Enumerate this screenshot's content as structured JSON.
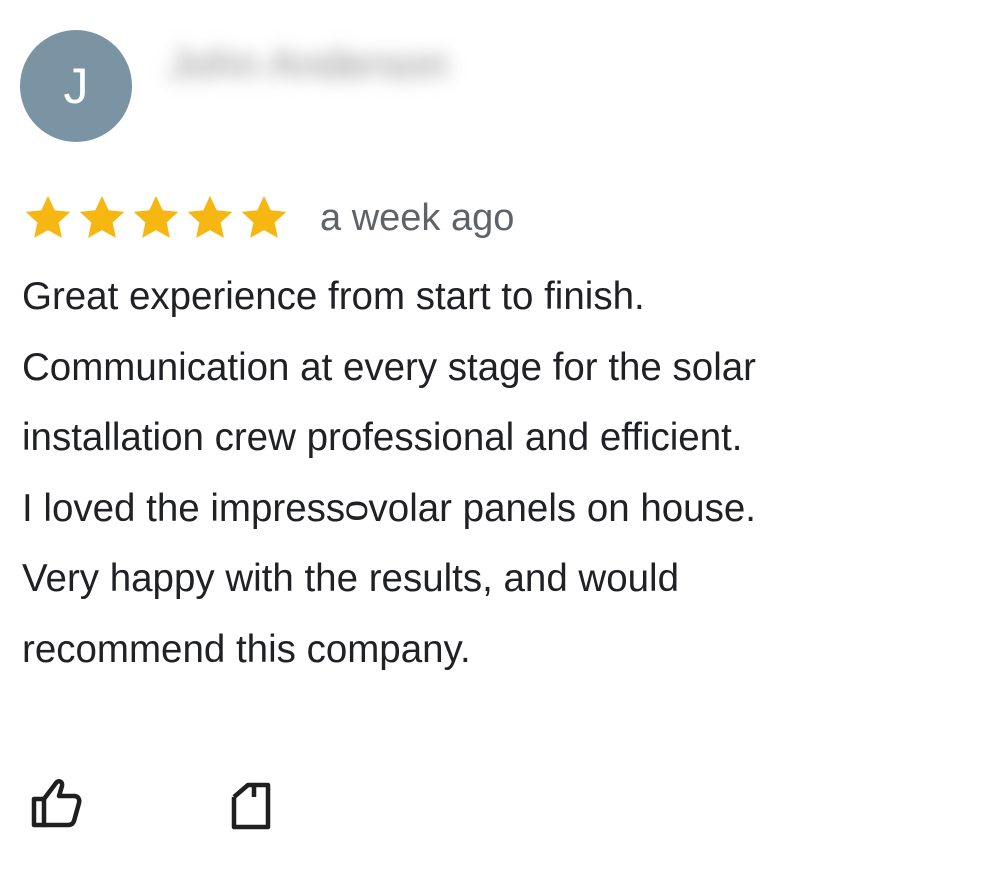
{
  "review": {
    "avatar_initial": "J",
    "author_name": "John Anderson",
    "rating": 5,
    "max_rating": 5,
    "star_color": "#f6b712",
    "date": "a week ago",
    "text_lines": [
      "Great experience from start to finish.",
      "Communication at every stage for the solar",
      "installation crew professional and efficient.",
      "I loved the impressᴑvolar panels on house.",
      "Very happy with the results, and would",
      "recommend this company."
    ]
  },
  "actions": {
    "like_icon": "thumbs-up-icon",
    "share_icon": "share-icon"
  },
  "colors": {
    "avatar_bg": "#7a94a4",
    "text": "#202124",
    "secondary_text": "#5f6368"
  }
}
